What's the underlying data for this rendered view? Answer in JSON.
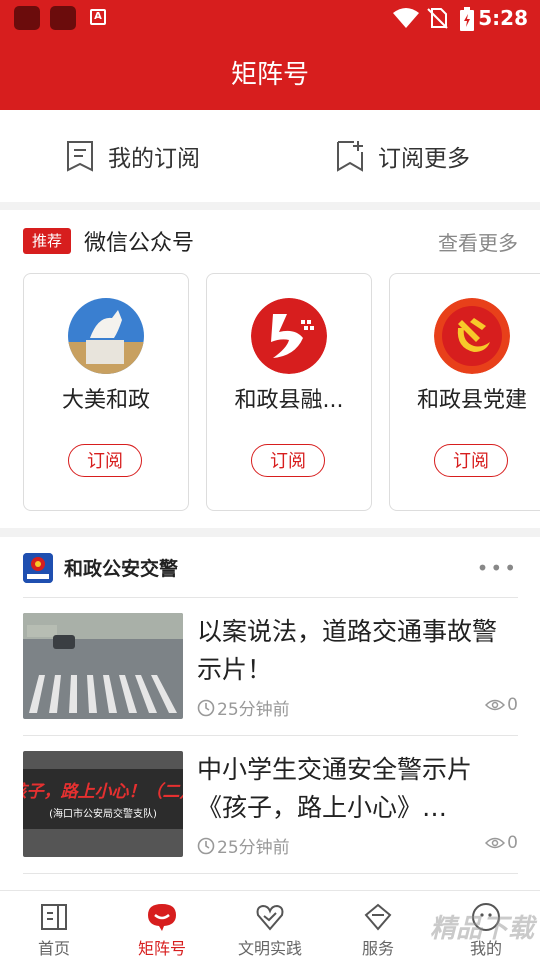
{
  "status_bar": {
    "time": "5:28"
  },
  "header": {
    "title": "矩阵号"
  },
  "subscribe_bar": {
    "my_subscriptions": "我的订阅",
    "subscribe_more": "订阅更多"
  },
  "recommend": {
    "badge": "推荐",
    "title": "微信公众号",
    "more": "查看更多",
    "cards": [
      {
        "name": "大美和政",
        "button": "订阅"
      },
      {
        "name": "和政县融...",
        "button": "订阅"
      },
      {
        "name": "和政县党建",
        "button": "订阅"
      }
    ]
  },
  "feed": {
    "source_name": "和政公安交警",
    "more_dots": "•••",
    "articles": [
      {
        "title": "以案说法，道路交通事故警示片！",
        "time": "25分钟前",
        "views": "0",
        "thumb_text": ""
      },
      {
        "title": "中小学生交通安全警示片《孩子，路上小心》…",
        "time": "25分钟前",
        "views": "0",
        "thumb_text": "孩子，路上小心！（二）",
        "thumb_sub": "(海口市公安局交警支队)"
      }
    ]
  },
  "bottom_nav": [
    {
      "label": "首页",
      "icon": "home-icon"
    },
    {
      "label": "矩阵号",
      "icon": "matrix-icon"
    },
    {
      "label": "文明实践",
      "icon": "heart-icon"
    },
    {
      "label": "服务",
      "icon": "service-icon"
    },
    {
      "label": "我的",
      "icon": "profile-icon"
    }
  ],
  "watermark": "精品下载",
  "colors": {
    "brand_red": "#d71e1e"
  }
}
